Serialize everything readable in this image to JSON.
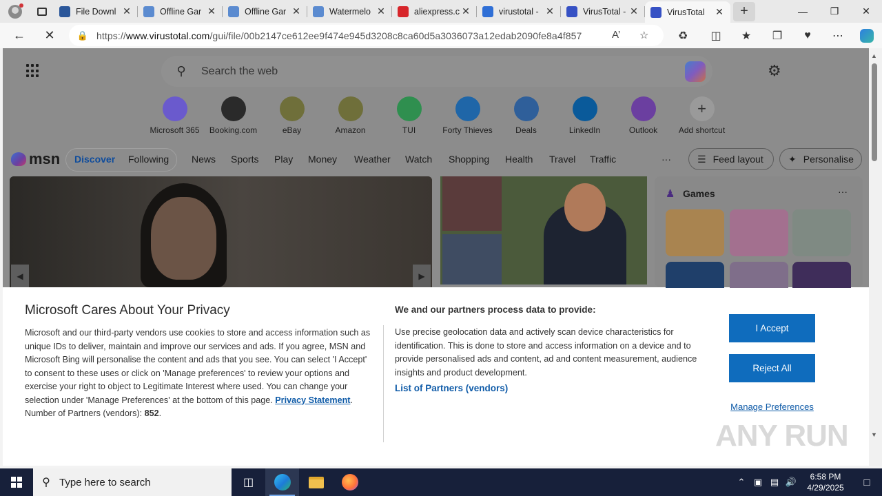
{
  "browser": {
    "tabs": [
      {
        "title": "File Downl",
        "favicon": "word-icon",
        "color": "#2b579a"
      },
      {
        "title": "Offline Gar",
        "favicon": "feather-icon",
        "color": "#5b8bd0"
      },
      {
        "title": "Offline Gar",
        "favicon": "feather-icon",
        "color": "#5b8bd0"
      },
      {
        "title": "Watermelo",
        "favicon": "feather-icon",
        "color": "#5b8bd0"
      },
      {
        "title": "aliexpress.c",
        "favicon": "aliexpress-icon",
        "color": "#d7262b"
      },
      {
        "title": "virustotal -",
        "favicon": "search-icon",
        "color": "#2f6fd6"
      },
      {
        "title": "VirusTotal -",
        "favicon": "virustotal-icon",
        "color": "#3651c4"
      },
      {
        "title": "VirusTotal",
        "favicon": "loading-icon",
        "color": "#3651c4",
        "active": true
      }
    ],
    "url_prefix": "https://",
    "url_domain": "www.virustotal.com",
    "url_path": "/gui/file/00b2147ce612ee9f474e945d3208c8ca60d5a3036073a12edab2090fe8a4f857"
  },
  "newtab": {
    "search_placeholder": "Search the web",
    "shortcuts": [
      {
        "label": "Microsoft 365",
        "icon": "m365-icon",
        "color": "#6a5acd"
      },
      {
        "label": "Booking.com",
        "icon": "booking-icon",
        "color": "#2a2a2a"
      },
      {
        "label": "eBay",
        "icon": "ebay-icon",
        "color": "#6f6f3a"
      },
      {
        "label": "Amazon",
        "icon": "amazon-icon",
        "color": "#6f6f3a"
      },
      {
        "label": "TUI",
        "icon": "tui-icon",
        "color": "#2f8f4f"
      },
      {
        "label": "Forty Thieves",
        "icon": "forty-thieves-icon",
        "color": "#1f66a8"
      },
      {
        "label": "Deals",
        "icon": "deals-icon",
        "color": "#2f5f9a"
      },
      {
        "label": "LinkedIn",
        "icon": "linkedin-icon",
        "color": "#0a5a9a"
      },
      {
        "label": "Outlook",
        "icon": "outlook-icon",
        "color": "#6b3fa0"
      },
      {
        "label": "Add shortcut",
        "icon": "plus-icon",
        "color": "#9a9a9a"
      }
    ],
    "msn_logo": "msn",
    "nav": {
      "discover": "Discover",
      "following": "Following",
      "items": [
        "News",
        "Sports",
        "Play",
        "Money",
        "Weather",
        "Watch",
        "Shopping",
        "Health",
        "Travel",
        "Traffic"
      ],
      "more": "···",
      "feed_layout": "Feed layout",
      "personalise": "Personalise"
    },
    "games_title": "Games",
    "games_more": "···"
  },
  "privacy": {
    "title": "Microsoft Cares About Your Privacy",
    "body": "Microsoft and our third-party vendors use cookies to store and access information such as unique IDs to deliver, maintain and improve our services and ads. If you agree, MSN and Microsoft Bing will personalise the content and ads that you see. You can select 'I Accept' to consent to these uses or click on 'Manage preferences' to review your options and exercise your right to object to Legitimate Interest where used.  You can change your selection under 'Manage Preferences' at the bottom of this page.",
    "privacy_link": "Privacy Statement",
    "partners_label": "Number of Partners (vendors):",
    "partners_count": "852",
    "right_title": "We and our partners process data to provide:",
    "right_body": "Use precise geolocation data and actively scan device characteristics for identification. This is done to store and access information on a device and to provide personalised ads and content, ad and content measurement, audience insights and product development.",
    "list_link": "List of Partners (vendors)",
    "accept": "I Accept",
    "reject": "Reject All",
    "manage": "Manage Preferences"
  },
  "watermark": "ANY RUN",
  "taskbar": {
    "search_placeholder": "Type here to search",
    "time": "6:58 PM",
    "date": "4/29/2025"
  }
}
